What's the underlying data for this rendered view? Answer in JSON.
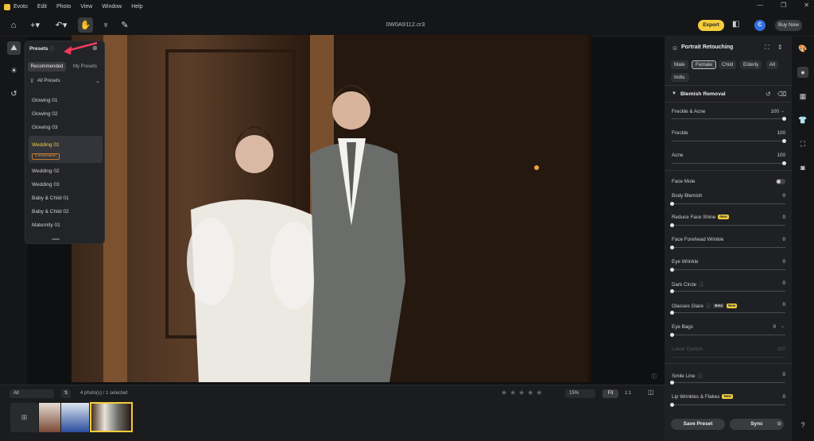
{
  "app": {
    "name": "Evoto",
    "menus": [
      "Edit",
      "Photo",
      "View",
      "Window",
      "Help"
    ]
  },
  "file": {
    "name": "0W0A9112.cr3"
  },
  "toolbar": {
    "export_label": "Export",
    "buy_label": "Buy Now",
    "avatar_letter": "C"
  },
  "presets": {
    "title": "Presets",
    "tabs": [
      "Recommended",
      "My Presets"
    ],
    "filter": "All Presets",
    "items": [
      "Glowing 01",
      "Glowing 02",
      "Glowing 03",
      "Wedding 01",
      "Wedding 02",
      "Wedding 03",
      "Baby & Child 01",
      "Baby & Child 02",
      "Maternity 01"
    ],
    "selected_tag": "Combination"
  },
  "filmstrip": {
    "filter": "All",
    "count": "4 photo(s) / 1 selected",
    "zoom": "15%",
    "fit_label": "Fit",
    "one_label": "1:1"
  },
  "right": {
    "section_title": "Portrait Retouching",
    "chips": [
      "Male",
      "Female",
      "Child",
      "Elderly",
      "All",
      "Indiv."
    ],
    "subsection": "Blemish Removal",
    "sliders": [
      {
        "label": "Freckle & Acne",
        "value": "100"
      },
      {
        "label": "Freckle",
        "value": "100"
      },
      {
        "label": "Acne",
        "value": "100"
      },
      {
        "label": "Face Mole",
        "value": ""
      },
      {
        "label": "Body Blemish",
        "value": "0"
      },
      {
        "label": "Reduce Face Shine",
        "value": "0"
      },
      {
        "label": "Face Forehead Wrinkle",
        "value": "0"
      },
      {
        "label": "Eye Wrinkle",
        "value": "0"
      },
      {
        "label": "Dark Circle",
        "value": "0"
      },
      {
        "label": "Glasses Glare",
        "value": "0"
      },
      {
        "label": "Eye Bags",
        "value": "0"
      },
      {
        "label": "Lower Eyelids",
        "value": "100"
      },
      {
        "label": "Smile Line",
        "value": "0"
      },
      {
        "label": "Lip Wrinkles & Flakes",
        "value": "0"
      }
    ],
    "badge_new": "New",
    "badge_beta": "Beta",
    "save_label": "Save Preset",
    "sync_label": "Sync"
  }
}
